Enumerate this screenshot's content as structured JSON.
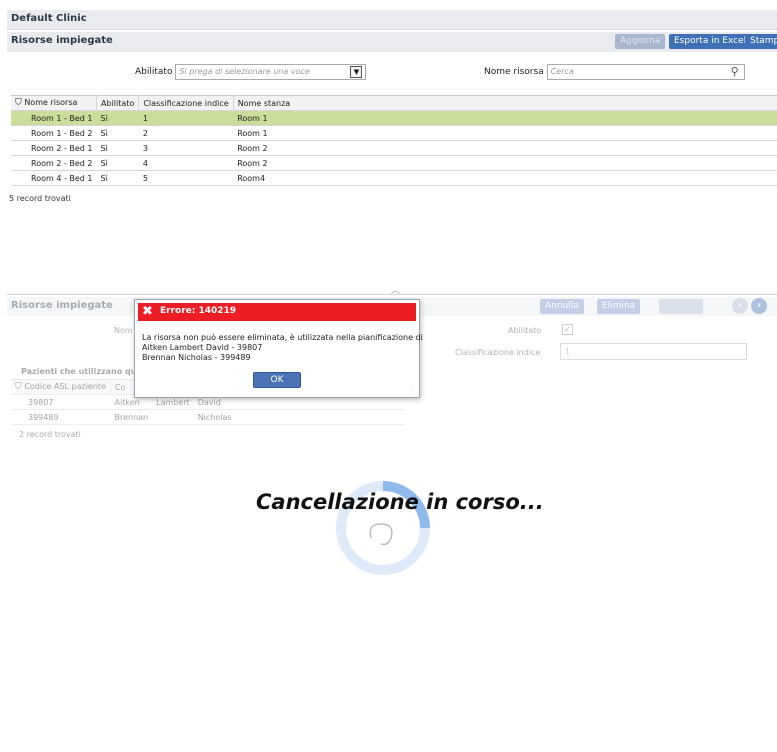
{
  "header": {
    "clinic": "Default Clinic"
  },
  "list_section": {
    "title": "Risorse impiegate",
    "buttons": {
      "aggiorna": "Aggiorna",
      "esporta": "Esporta in Excel",
      "stampa": "Stampa"
    }
  },
  "filters": {
    "abilitato_label": "Abilitato",
    "abilitato_placeholder": "Si prega di selezionare una voce",
    "nome_label": "Nome risorsa",
    "nome_placeholder": "Cerca"
  },
  "resources_table": {
    "columns": [
      "Nome risorsa",
      "Abilitato",
      "Classificazione indice",
      "Nome stanza"
    ],
    "rows": [
      {
        "nome": "Room 1 - Bed 1",
        "abilitato": "Sì",
        "indice": "1",
        "stanza": "Room 1"
      },
      {
        "nome": "Room 1 - Bed 2",
        "abilitato": "Sì",
        "indice": "2",
        "stanza": "Room 1"
      },
      {
        "nome": "Room 2 - Bed 1",
        "abilitato": "Sì",
        "indice": "3",
        "stanza": "Room 2"
      },
      {
        "nome": "Room 2 - Bed 2",
        "abilitato": "Sì",
        "indice": "4",
        "stanza": "Room 2"
      },
      {
        "nome": "Room 4 - Bed 1",
        "abilitato": "Sì",
        "indice": "5",
        "stanza": "Room4"
      }
    ],
    "record_count": "5 record trovati"
  },
  "detail_section": {
    "title": "Risorse impiegate",
    "buttons": {
      "annulla": "Annulla",
      "elimina": "Elimina",
      "salva": "Salva"
    },
    "nome_label": "Nom",
    "abilitato_label": "Abilitato",
    "classificazione_label": "Classificazione indice",
    "classificazione_value": "1",
    "patients_title": "Pazienti che utilizzano ques",
    "patients_columns": [
      "Codice ASL paziente",
      "Co"
    ],
    "patients_rows": [
      {
        "codice": "39807",
        "c1": "Aitken",
        "c2": "Lambert",
        "c3": "David"
      },
      {
        "codice": "399489",
        "c1": "Brennan",
        "c2": "",
        "c3": "Nicholas"
      }
    ],
    "patients_count": "2 record trovati"
  },
  "loading_overlay": {
    "text": "Cancellazione in corso..."
  },
  "error_dialog": {
    "title": "Errore:  140219",
    "message_line1": "La risorsa non può essere eliminata, è utilizzata nella pianificazione di",
    "message_line2": "Aitken Lambert David - 39807",
    "message_line3": "Brennan  Nicholas - 399489",
    "ok_label": "OK"
  },
  "colors": {
    "header_bg": "#e9ebee",
    "selected_row": "#cadd9b",
    "error_red": "#ee1c24",
    "primary_button": "#3f6fb4",
    "spinner": "#3f8be0"
  }
}
